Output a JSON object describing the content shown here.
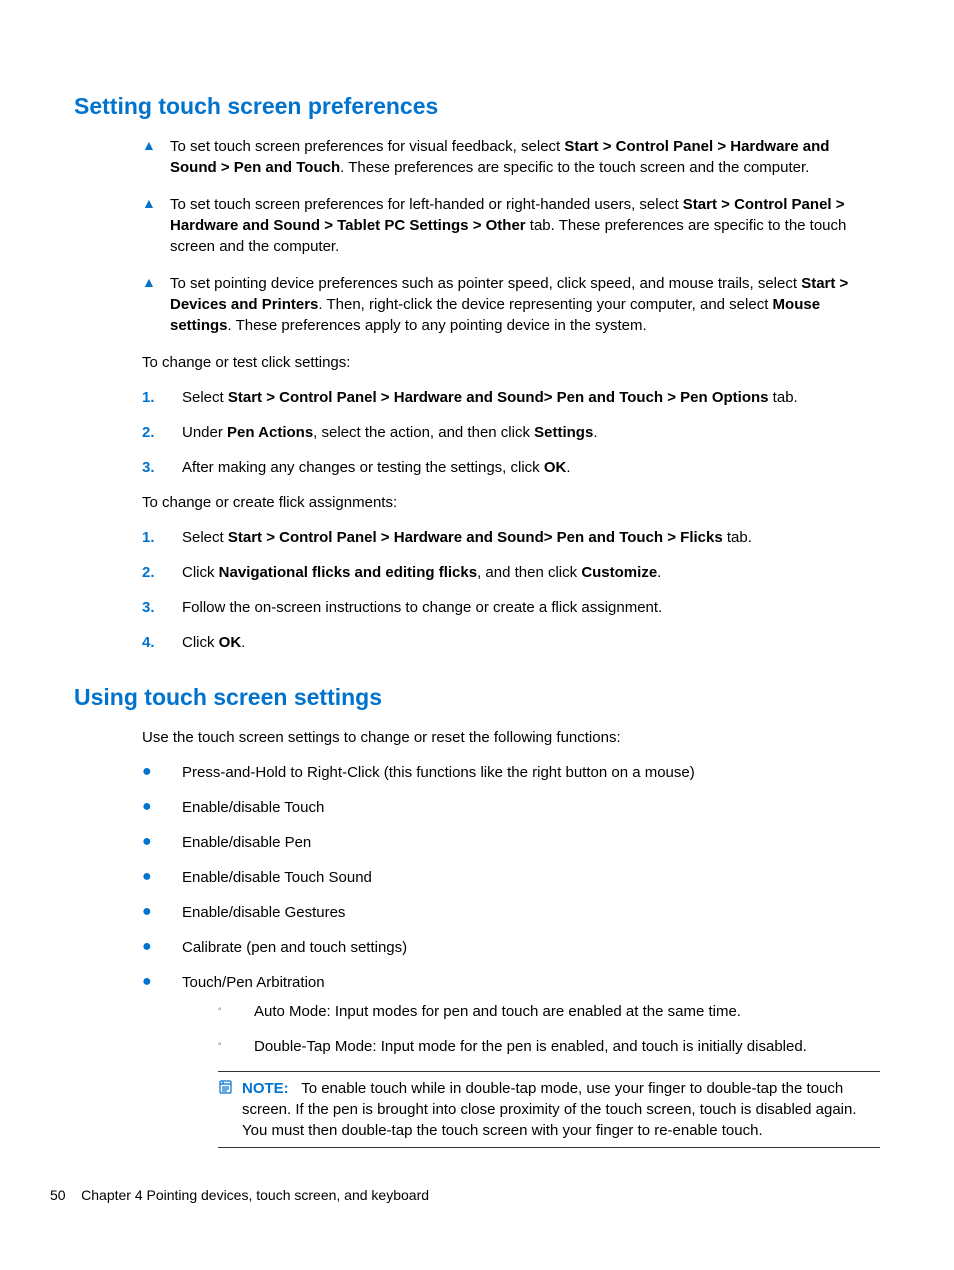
{
  "sec1": {
    "heading": "Setting touch screen preferences",
    "tri1_a": "To set touch screen preferences for visual feedback, select ",
    "tri1_b": "Start > Control Panel > Hardware and Sound > Pen and Touch",
    "tri1_c": ". These preferences are specific to the touch screen and the computer.",
    "tri2_a": "To set touch screen preferences for left-handed or right-handed users, select ",
    "tri2_b": "Start > Control Panel > Hardware and Sound > Tablet PC Settings > Other",
    "tri2_c": " tab. These preferences are specific to the touch screen and the computer.",
    "tri3_a": "To set pointing device preferences such as pointer speed, click speed, and mouse trails, select ",
    "tri3_b": "Start > Devices and Printers",
    "tri3_c": ". Then, right-click the device representing your computer, and select ",
    "tri3_d": "Mouse settings",
    "tri3_e": ". These preferences apply to any pointing device in the system.",
    "para1": "To change or test click settings:",
    "n1_a": "Select ",
    "n1_b": "Start > Control Panel > Hardware and Sound> Pen and Touch > Pen Options",
    "n1_c": " tab.",
    "n2_a": "Under ",
    "n2_b": "Pen Actions",
    "n2_c": ", select the action, and then click ",
    "n2_d": "Settings",
    "n2_e": ".",
    "n3_a": "After making any changes or testing the settings, click ",
    "n3_b": "OK",
    "n3_c": ".",
    "para2": "To change or create flick assignments:",
    "m1_a": "Select ",
    "m1_b": "Start > Control Panel > Hardware and Sound> Pen and Touch > Flicks",
    "m1_c": " tab.",
    "m2_a": "Click ",
    "m2_b": "Navigational flicks and editing flicks",
    "m2_c": ", and then click ",
    "m2_d": "Customize",
    "m2_e": ".",
    "m3": "Follow the on-screen instructions to change or create a flick assignment.",
    "m4_a": "Click ",
    "m4_b": "OK",
    "m4_c": "."
  },
  "sec2": {
    "heading": "Using touch screen settings",
    "para": "Use the touch screen settings to change or reset the following functions:",
    "b1": "Press-and-Hold to Right-Click (this functions like the right button on a mouse)",
    "b2": "Enable/disable Touch",
    "b3": "Enable/disable Pen",
    "b4": "Enable/disable Touch Sound",
    "b5": "Enable/disable Gestures",
    "b6": "Calibrate (pen and touch settings)",
    "b7": "Touch/Pen Arbitration",
    "c1": "Auto Mode: Input modes for pen and touch are enabled at the same time.",
    "c2": "Double-Tap Mode: Input mode for the pen is enabled, and touch is initially disabled.",
    "note_label": "NOTE:",
    "note_text": "To enable touch while in double-tap mode, use your finger to double-tap the touch screen. If the pen is brought into close proximity of the touch screen, touch is disabled again. You must then double-tap the touch screen with your finger to re-enable touch."
  },
  "footer": {
    "page": "50",
    "chapter": "Chapter 4   Pointing devices, touch screen, and keyboard"
  },
  "marks": {
    "tri": "▲",
    "dot": "●",
    "circ": "◦",
    "n1": "1.",
    "n2": "2.",
    "n3": "3.",
    "n4": "4."
  }
}
